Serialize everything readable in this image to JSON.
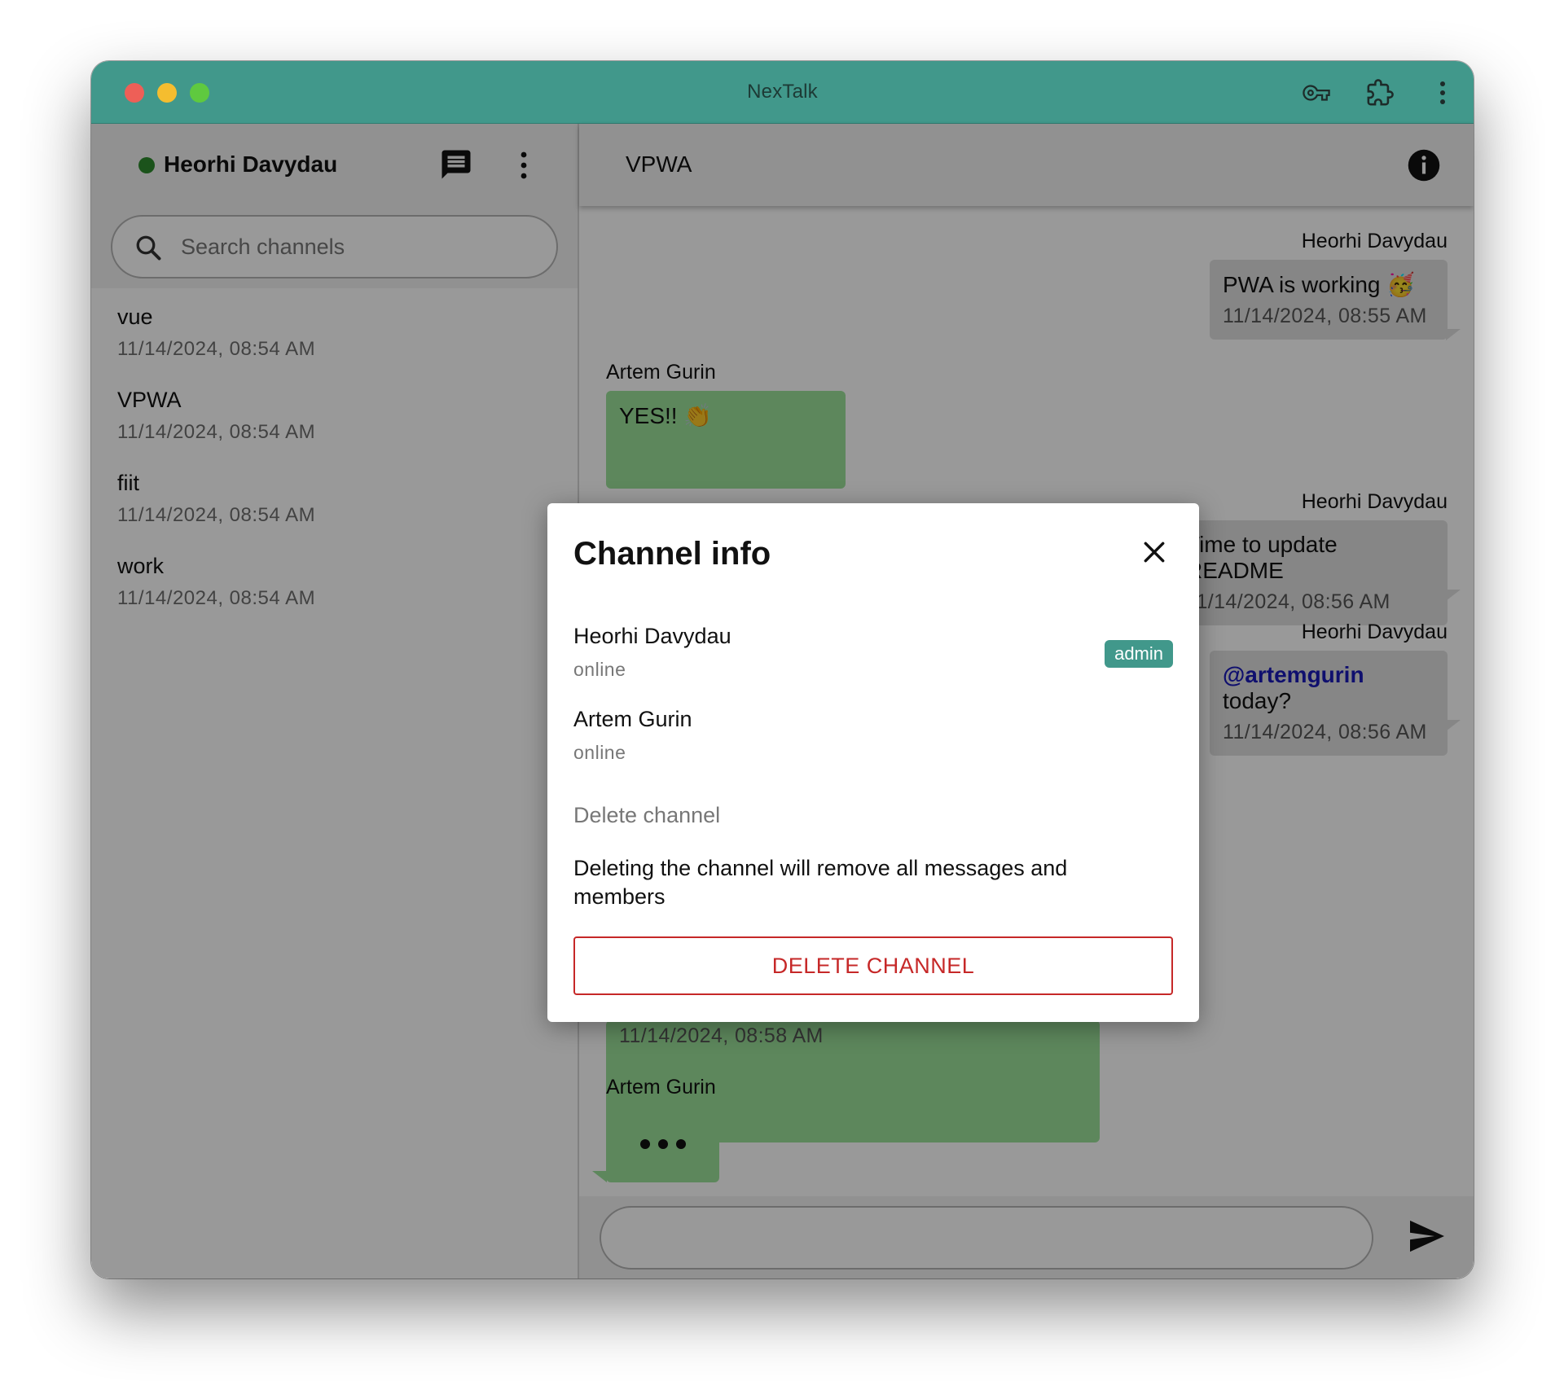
{
  "window": {
    "title": "NexTalk"
  },
  "sidebar": {
    "user_name": "Heorhi Davydau",
    "search_placeholder": "Search channels",
    "channels": [
      {
        "name": "vue",
        "time": "11/14/2024, 08:54 AM"
      },
      {
        "name": "VPWA",
        "time": "11/14/2024, 08:54 AM"
      },
      {
        "name": "fiit",
        "time": "11/14/2024, 08:54 AM"
      },
      {
        "name": "work",
        "time": "11/14/2024, 08:54 AM"
      }
    ]
  },
  "chat": {
    "title": "VPWA",
    "messages": [
      {
        "sender": "Heorhi Davydau",
        "text": "PWA is working 🥳",
        "time": "11/14/2024, 08:55 AM"
      },
      {
        "sender": "Artem Gurin",
        "text": "YES!! 👏"
      },
      {
        "sender": "Heorhi Davydau",
        "text": "Time to update README",
        "time": "11/14/2024, 08:56 AM"
      },
      {
        "sender": "Heorhi Davydau",
        "mention": "@artemgurin",
        "text": " today?",
        "time": "11/14/2024, 08:56 AM"
      },
      {
        "time": "11/14/2024, 08:58 AM"
      },
      {
        "sender": "Artem Gurin"
      }
    ]
  },
  "dialog": {
    "title": "Channel info",
    "members": [
      {
        "name": "Heorhi Davydau",
        "status": "online",
        "badge": "admin"
      },
      {
        "name": "Artem Gurin",
        "status": "online"
      }
    ],
    "delete_label": "Delete channel",
    "delete_description": "Deleting the channel will remove all messages and members",
    "delete_button": "DELETE CHANNEL"
  },
  "colors": {
    "accent": "#41988b",
    "incoming_bubble": "#9ce29a",
    "outgoing_bubble": "#e0e0e0",
    "danger": "#c62828",
    "online": "#2e8b2e"
  }
}
